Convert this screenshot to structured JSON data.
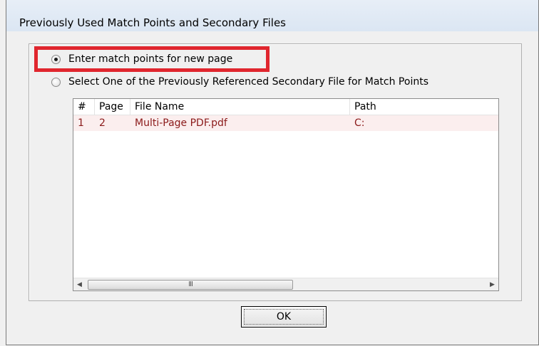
{
  "window": {
    "title": "Previously Used Match Points and Secondary Files"
  },
  "options": {
    "new_page_label": "Enter match points for new page",
    "new_page_selected": true,
    "secondary_file_label": "Select One of the Previously Referenced Secondary File for Match Points",
    "secondary_file_selected": false
  },
  "list": {
    "columns": [
      "#",
      "Page",
      "File Name",
      "Path"
    ],
    "rows": [
      {
        "num": "1",
        "page": "2",
        "file_name": "Multi-Page PDF.pdf",
        "path": "C:"
      }
    ],
    "scroll_grip": "III"
  },
  "buttons": {
    "ok_label": "OK"
  },
  "colors": {
    "highlight": "#e0262e",
    "row_text": "#8b1a1a",
    "row_background": "#fbeeee"
  }
}
